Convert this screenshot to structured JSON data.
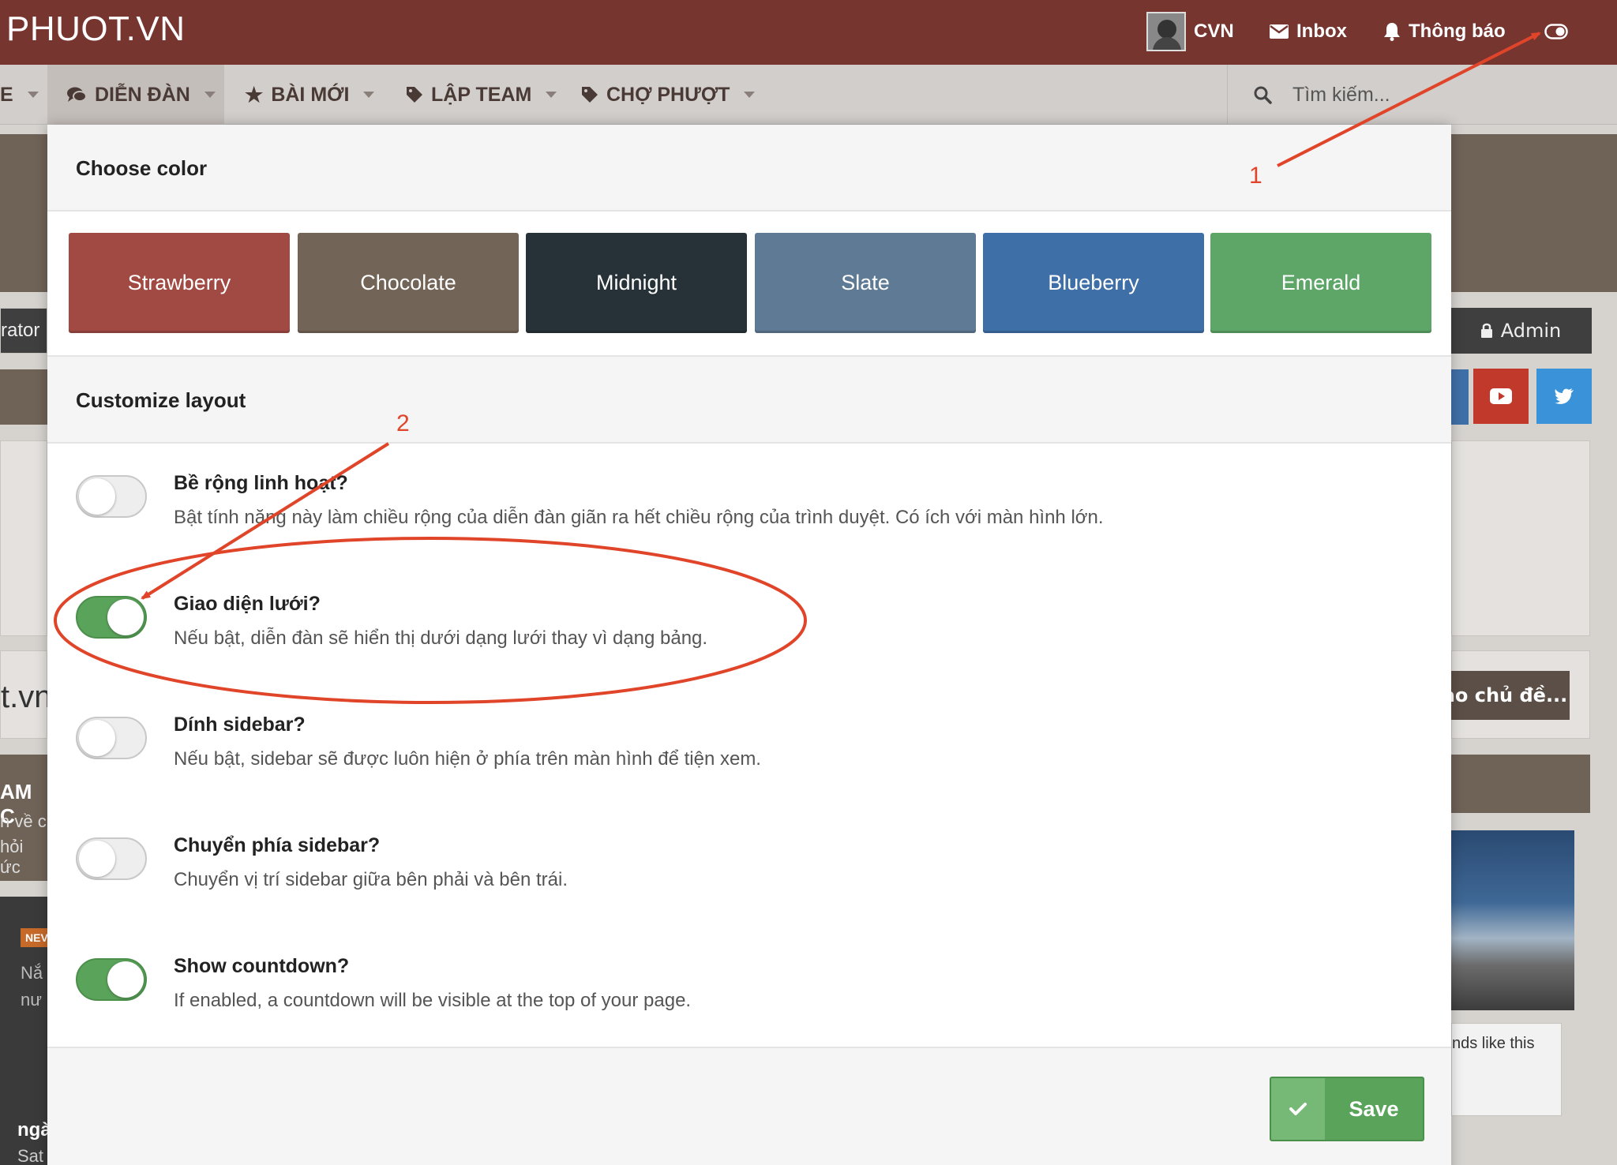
{
  "site": {
    "logo": "PHUOT.VN",
    "user": {
      "name": "CVN"
    },
    "inbox_label": "Inbox",
    "notifications_label": "Thông báo"
  },
  "nav": {
    "tabs": [
      {
        "label": "E"
      },
      {
        "label": "DIỄN ĐÀN"
      },
      {
        "label": "BÀI MỚI"
      },
      {
        "label": "LẬP TEAM"
      },
      {
        "label": "CHỢ PHƯỢT"
      }
    ],
    "search_placeholder": "Tìm kiếm..."
  },
  "background": {
    "moderator_fragment": "rator",
    "admin_label": "Admin",
    "site_fragment": "t.vn",
    "create_thread_fragment": "ạo chủ đề...",
    "promo_fragments": [
      "AM C",
      "n về c",
      "hỏi ức"
    ],
    "badge_new": "NEV",
    "list_fragments": [
      "Nắ",
      "nư"
    ],
    "bottom_fragments": [
      "ngà",
      "Sat"
    ],
    "likes_fragment": "nds like this"
  },
  "modal": {
    "color_section_title": "Choose color",
    "colors": [
      {
        "name": "Strawberry",
        "hex": "#a14a43"
      },
      {
        "name": "Chocolate",
        "hex": "#726457"
      },
      {
        "name": "Midnight",
        "hex": "#263238"
      },
      {
        "name": "Slate",
        "hex": "#5f7a94"
      },
      {
        "name": "Blueberry",
        "hex": "#3f6fa7"
      },
      {
        "name": "Emerald",
        "hex": "#5da668"
      }
    ],
    "layout_section_title": "Customize layout",
    "options": [
      {
        "title": "Bề rộng linh hoạt?",
        "description": "Bật tính năng này làm chiều rộng của diễn đàn giãn ra hết chiều rộng của trình duyệt. Có ích với màn hình lớn.",
        "enabled": false
      },
      {
        "title": "Giao diện lưới?",
        "description": "Nếu bật, diễn đàn sẽ hiển thị dưới dạng lưới thay vì dạng bảng.",
        "enabled": true
      },
      {
        "title": "Dính sidebar?",
        "description": "Nếu bật, sidebar sẽ được luôn hiện ở phía trên màn hình để tiện xem.",
        "enabled": false
      },
      {
        "title": "Chuyển phía sidebar?",
        "description": "Chuyển vị trí sidebar giữa bên phải và bên trái.",
        "enabled": false
      },
      {
        "title": "Show countdown?",
        "description": "If enabled, a countdown will be visible at the top of your page.",
        "enabled": true
      }
    ],
    "save_label": "Save"
  },
  "annotations": {
    "label_1": "1",
    "label_2": "2",
    "color": "#e0452a"
  }
}
